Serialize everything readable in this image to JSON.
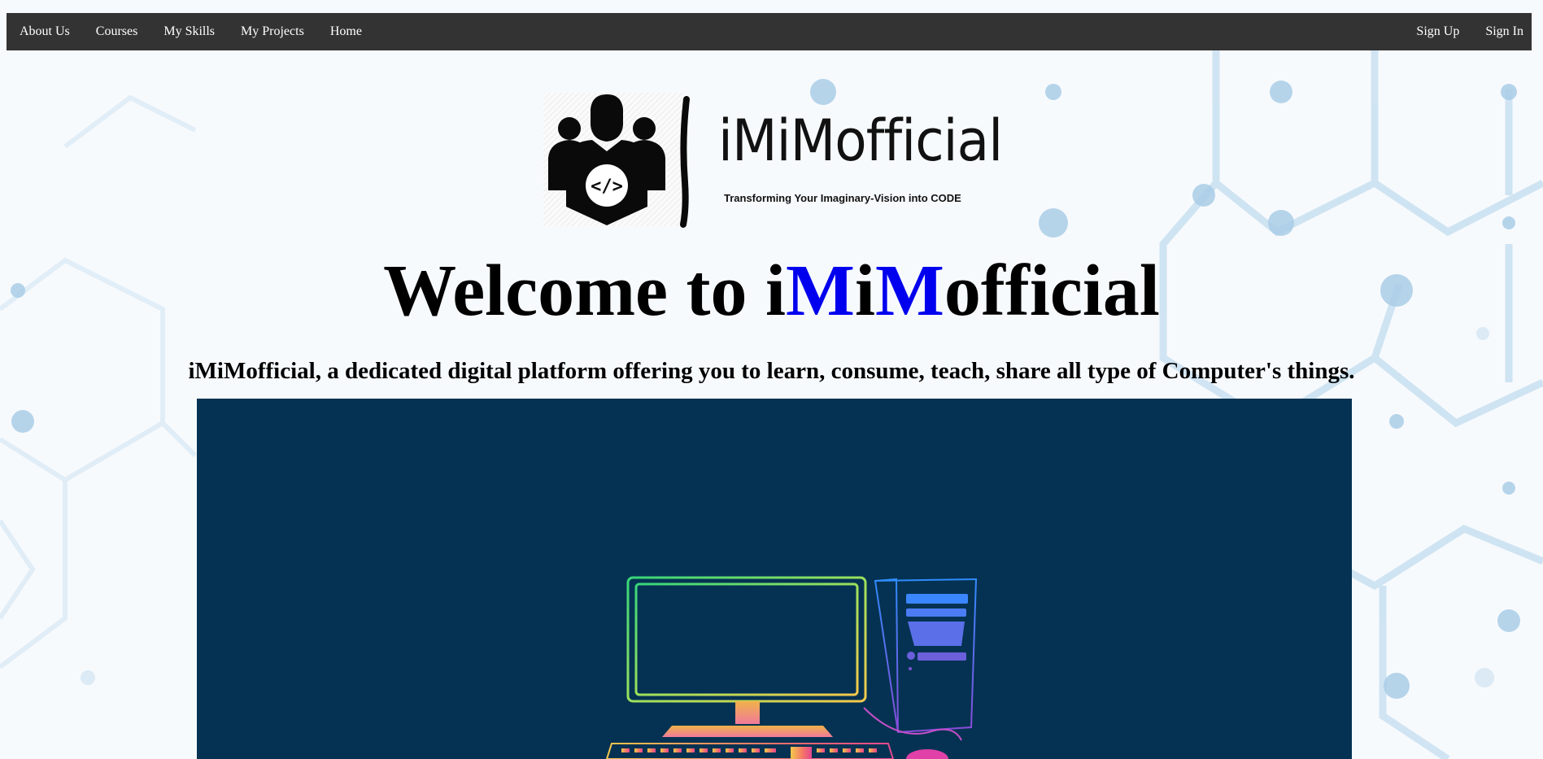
{
  "nav": {
    "left": [
      "About Us",
      "Courses",
      "My Skills",
      "My Projects",
      "Home"
    ],
    "right": [
      "Sign Up",
      "Sign In"
    ]
  },
  "logo": {
    "name": "iMiMofficial",
    "tagline": "Transforming Your Imaginary-Vision into CODE",
    "code_symbol": "</>"
  },
  "welcome": {
    "prefix": "Welcome to ",
    "parts": [
      "i",
      "M",
      "i",
      "M",
      "official"
    ]
  },
  "tagline": "iMiMofficial, a dedicated digital platform offering you to learn, consume, teach, share all type of Computer's things.",
  "colors": {
    "navbar": "#333333",
    "accent_blue": "#0000ee",
    "hero_bg": "#053252",
    "hex_pattern": "#a9cde6"
  },
  "icons": {
    "logo": "developer-team-icon",
    "hero": "desktop-computer-illustration"
  }
}
